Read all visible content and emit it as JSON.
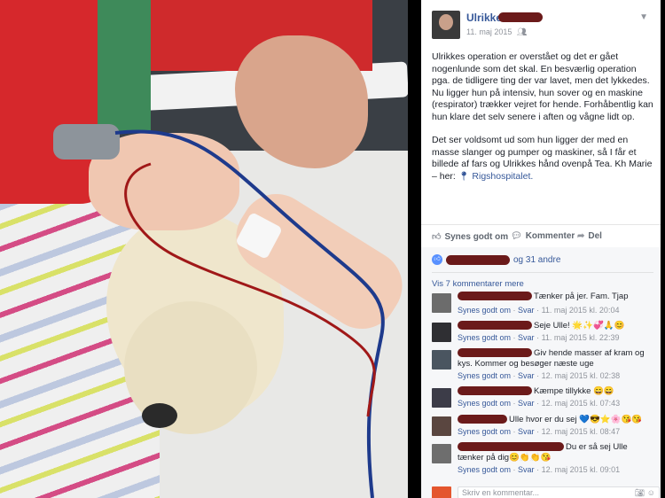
{
  "post": {
    "author": "Ulrikke",
    "date": "11. maj 2015",
    "audience_icon": "friends-icon",
    "paragraph1": "Ulrikkes operation er overstået og det er gået nogenlunde som det skal. En besværlig operation pga. de tidligere ting der var lavet, men det lykkedes. Nu ligger hun på intensiv, hun sover og en maskine (respirator) trækker vejret for hende. Forhåbentlig kan hun klare det selv senere i aften og vågne lidt op.",
    "paragraph2_text": "Det ser voldsomt ud som hun ligger der med en masse slanger og pumper og maskiner, så I får et billede af fars og Ulrikkes hånd ovenpå Tea. Kh Marie – her: ",
    "location": "Rigshospitalet."
  },
  "actions": {
    "like": "Synes godt om",
    "comment": "Kommenter",
    "share": "Del"
  },
  "likes": {
    "others": "og 31 andre"
  },
  "view_more": "Vis 7 kommentarer mere",
  "comments": [
    {
      "text": "Tænker på jer. Fam. Tjap",
      "like": "Synes godt om",
      "reply": "Svar",
      "time": "11. maj 2015 kl. 20:04"
    },
    {
      "text": "Seje Ulle! 🌟✨💞🙏😊",
      "like": "Synes godt om",
      "reply": "Svar",
      "time": "11. maj 2015 kl. 22:39"
    },
    {
      "text": "Giv hende masser af kram og kys. Kommer og besøger næste uge",
      "like": "Synes godt om",
      "reply": "Svar",
      "time": "12. maj 2015 kl. 02:38"
    },
    {
      "text": "Kæmpe tillykke 😄😄",
      "like": "Synes godt om",
      "reply": "Svar",
      "time": "12. maj 2015 kl. 07:43"
    },
    {
      "text": "Ulle hvor er du sej 💙😎⭐🌸😘😘",
      "like": "Synes godt om",
      "reply": "Svar",
      "time": "12. maj 2015 kl. 08:47"
    },
    {
      "text": "Du er så sej Ulle tænker på dig😊👏👏😘",
      "like": "Synes godt om",
      "reply": "Svar",
      "time": "12. maj 2015 kl. 09:01"
    }
  ],
  "write_comment": {
    "placeholder": "Skriv en kommentar..."
  },
  "colors": {
    "link": "#365899",
    "muted": "#90949c",
    "text": "#1d2129",
    "redaction": "#6b1a1a"
  }
}
